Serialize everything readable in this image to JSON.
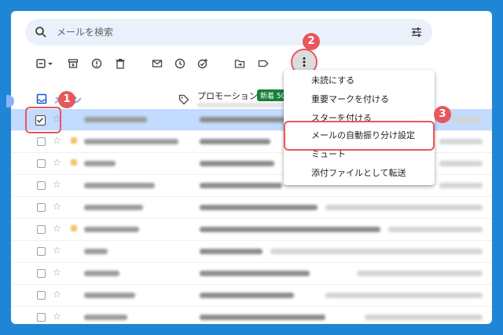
{
  "search": {
    "placeholder": "メールを検索"
  },
  "tabs": {
    "main": {
      "label": "メイン"
    },
    "promotions": {
      "label": "プロモーション",
      "badge": "新着 50"
    }
  },
  "menu": {
    "items": [
      {
        "label": "未読にする"
      },
      {
        "label": "重要マークを付ける"
      },
      {
        "label": "スターを付ける"
      },
      {
        "label": "メールの自動振り分け設定"
      },
      {
        "label": "ミュート"
      },
      {
        "label": "添付ファイルとして転送"
      }
    ]
  },
  "markers": [
    "1",
    "2",
    "3"
  ],
  "rows": [
    {
      "selected": true
    },
    {
      "important": true
    },
    {
      "important": true
    },
    {
      "important": false
    },
    {
      "important": false
    },
    {
      "important": true
    },
    {
      "important": false
    },
    {
      "important": false
    },
    {
      "important": false
    },
    {
      "important": false
    }
  ],
  "colors": {
    "accent": "#0b57d0",
    "marker": "#e8575c",
    "frame": "#1f86d6",
    "badge": "#188038",
    "selected_row": "#c2dbff"
  }
}
